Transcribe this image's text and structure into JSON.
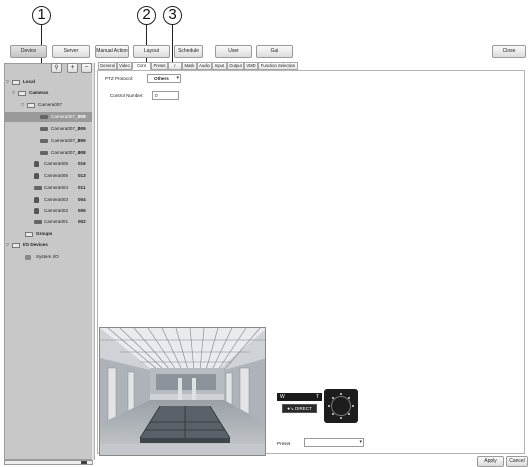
{
  "callouts": [
    "1",
    "2",
    "3"
  ],
  "topnav": {
    "device": "Device",
    "server": "Server",
    "manual_action": "Manual Action",
    "layout": "Layout",
    "schedule": "Schedule",
    "user": "User",
    "gui": "Gui",
    "close": "Close"
  },
  "tree": {
    "toolbar": [
      "+",
      "−"
    ],
    "local": "Local",
    "cameras": "Cameras",
    "camera007": "Camera007",
    "sub": [
      {
        "label": "Camera007_1",
        "num": "008"
      },
      {
        "label": "Camera007_2",
        "num": "009"
      },
      {
        "label": "Camera007_3",
        "num": "009"
      },
      {
        "label": "Camera007_4",
        "num": "008"
      }
    ],
    "cams": [
      {
        "label": "Camera006",
        "num": "016"
      },
      {
        "label": "Camera005",
        "num": "013"
      },
      {
        "label": "Camera004",
        "num": "011"
      },
      {
        "label": "Camera003",
        "num": "004"
      },
      {
        "label": "Camera002",
        "num": "005"
      },
      {
        "label": "Camera001",
        "num": "002"
      }
    ],
    "groups": "Groups",
    "io_devices": "I/O Devices",
    "system_io": "System I/O"
  },
  "tabs": [
    "General",
    "Video",
    "Cont",
    "Preset",
    "r",
    "Mask",
    "Audio",
    "Input",
    "Output",
    "VMD",
    "Function Selection"
  ],
  "form": {
    "ptz_protocol_label": "PTZ Protocol:",
    "ptz_protocol_value": "Others",
    "control_number_label": "Control Number:",
    "control_number_value": "0"
  },
  "ptz": {
    "zoom_w": "W",
    "zoom_t": "T",
    "direct_label": "DIRECT",
    "preset_label": "Preset",
    "preset_value": ""
  },
  "footer": {
    "apply": "Apply",
    "cancel": "Cancel"
  }
}
